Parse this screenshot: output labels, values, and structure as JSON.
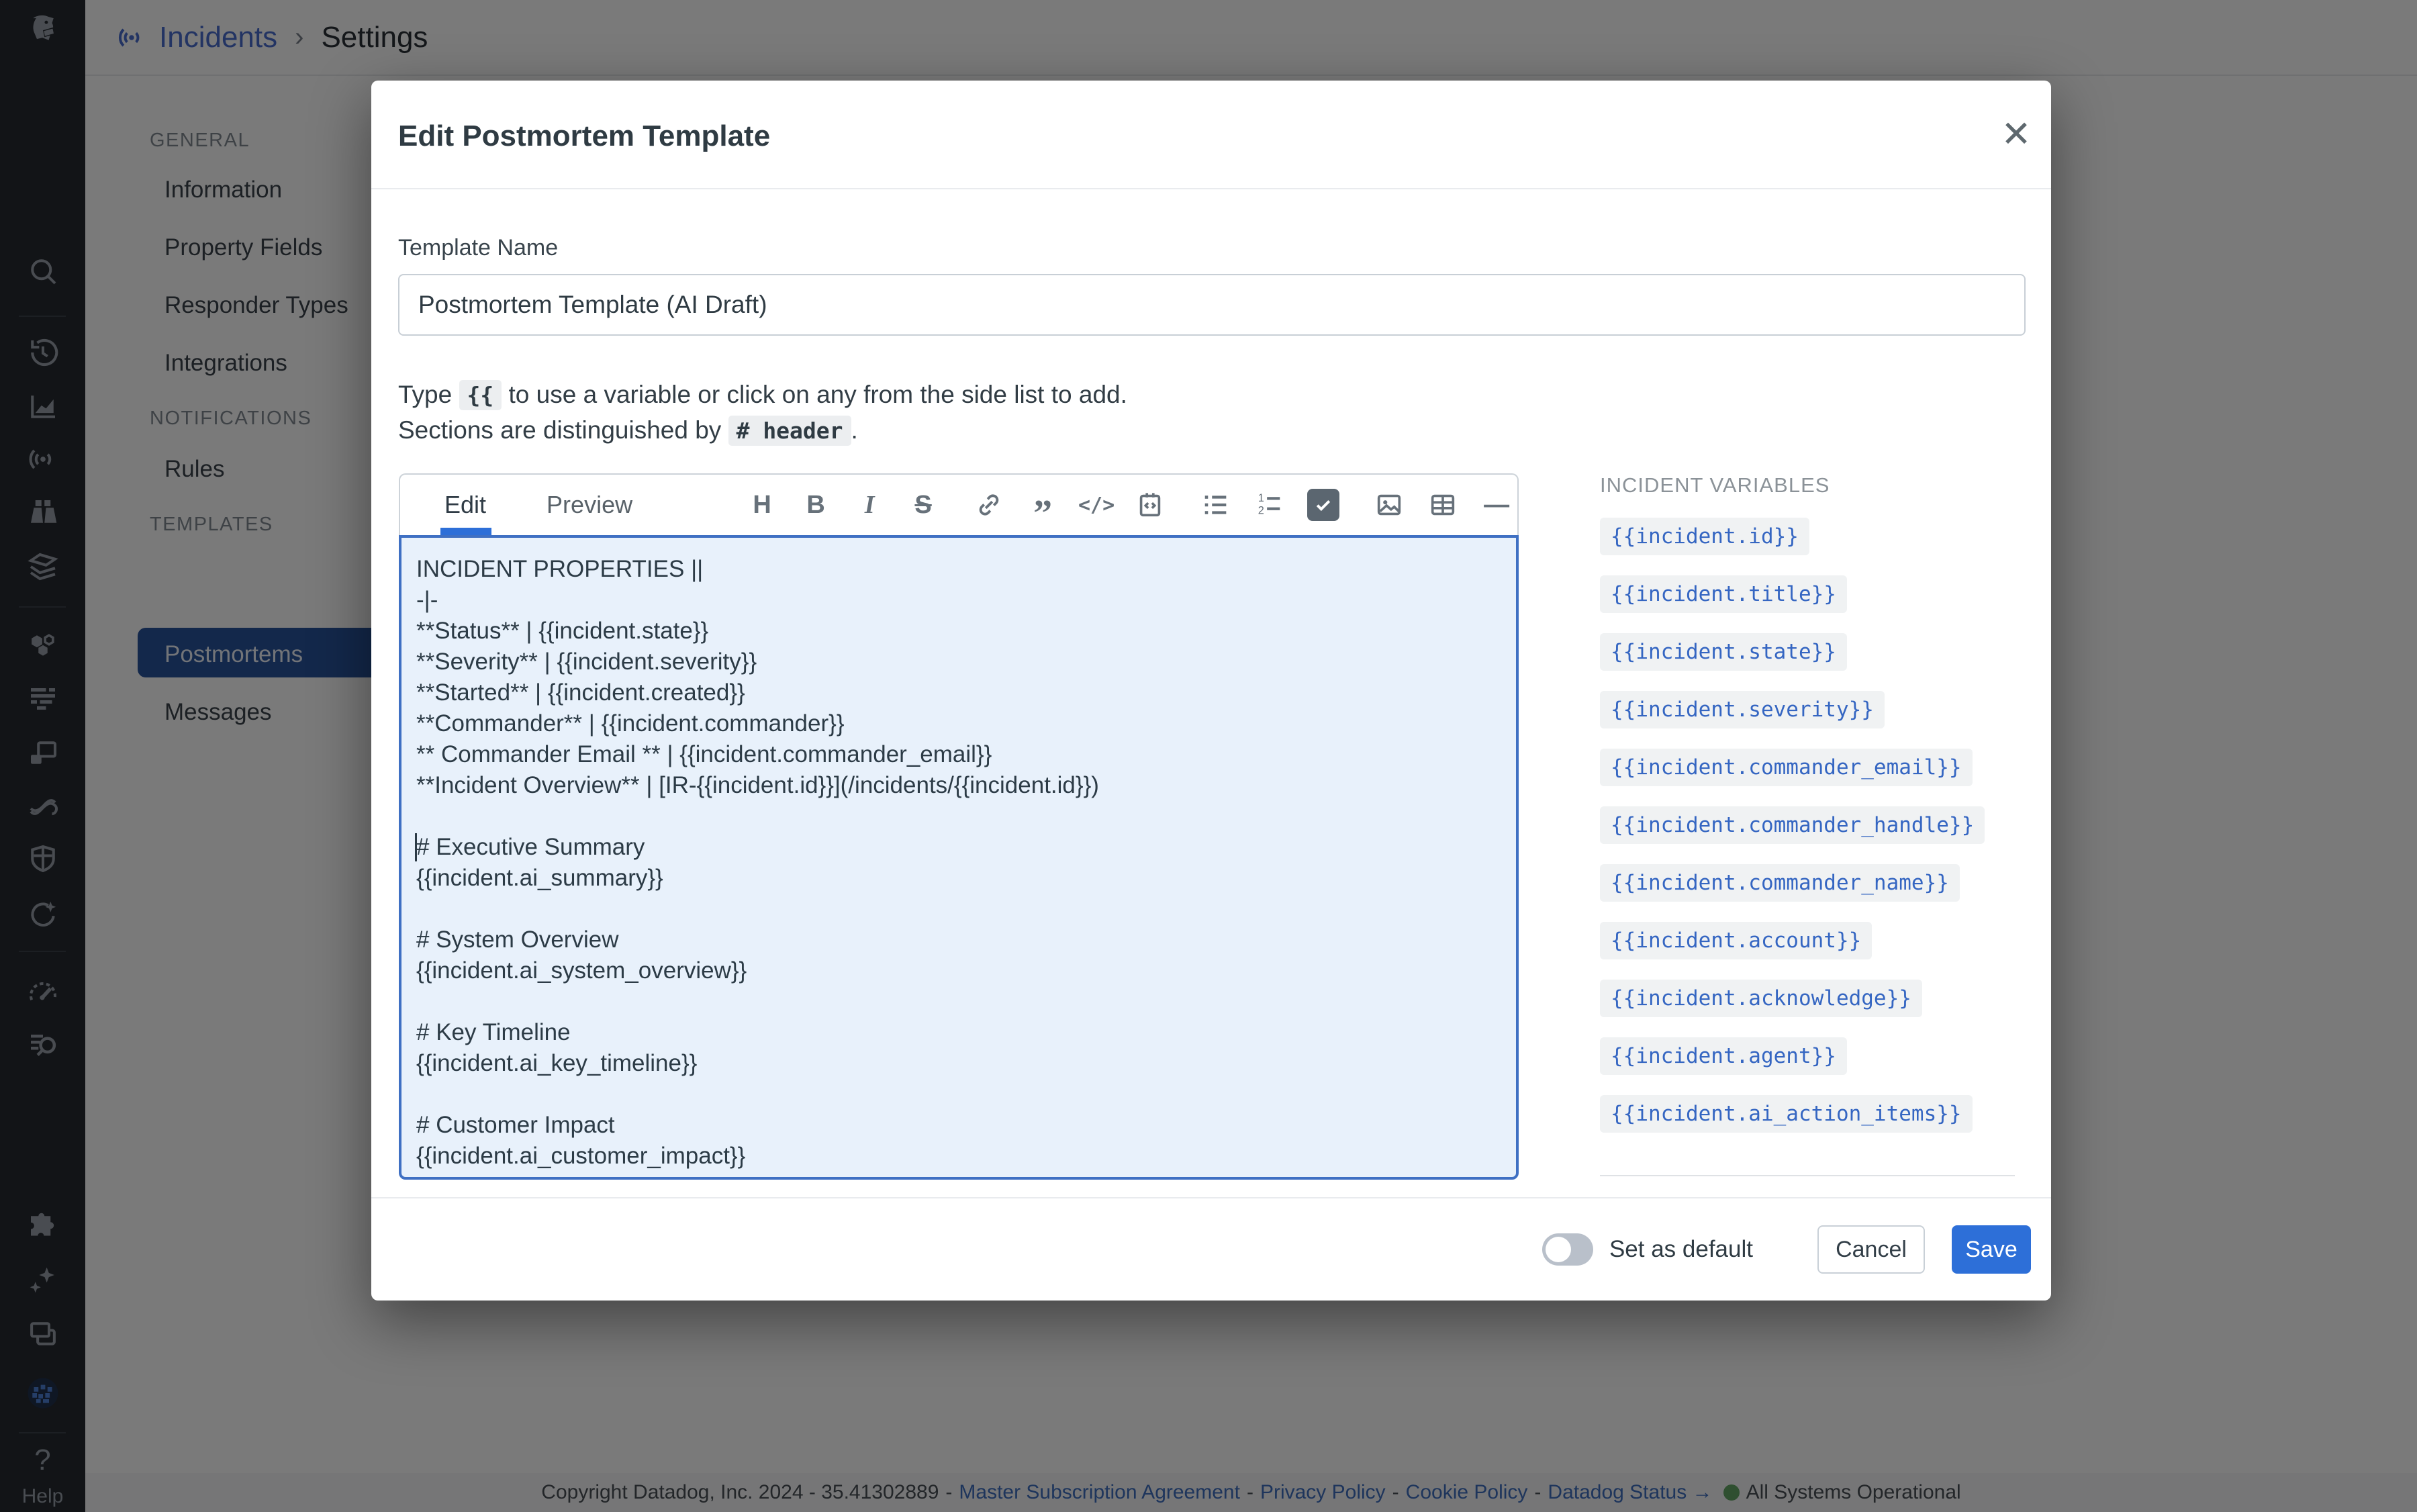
{
  "colors": {
    "accent_blue": "#2d6fd8",
    "editor_background": "#e8f1fb",
    "editor_border": "#3f70c3",
    "selected_nav_pill": "#29549e",
    "variable_text": "#3566c2",
    "status_green": "#62a564"
  },
  "rail": {
    "icons": [
      "datadog-logo",
      "search",
      "history",
      "metrics-chart",
      "incidents-radar",
      "watchdog-binoculars",
      "dashboards-layers",
      "infrastructure-hexagons",
      "logs-lines",
      "apm-windows",
      "pipelines-curve",
      "security-shield",
      "ai-circle-sparkle",
      "monitors-gauge",
      "log-explorer-search",
      "integrations-puzzle",
      "bits-ai-sparkles",
      "workflows-windows",
      "user-avatar-pixel-dog"
    ],
    "help_icon_glyph": "?",
    "help_label": "Help"
  },
  "header": {
    "breadcrumb": {
      "product": "Incidents",
      "separator": "›",
      "page": "Settings"
    }
  },
  "sidebar": {
    "sections": [
      {
        "label": "GENERAL",
        "items": [
          "Information",
          "Property Fields",
          "Responder Types",
          "Integrations"
        ]
      },
      {
        "label": "NOTIFICATIONS",
        "items": [
          "Rules"
        ]
      },
      {
        "label": "TEMPLATES",
        "items": [
          "Postmortems",
          "Messages"
        ],
        "selected_item": "Postmortems"
      }
    ]
  },
  "modal": {
    "title": "Edit Postmortem Template",
    "close_glyph": "✕",
    "template_name": {
      "label": "Template Name",
      "value": "Postmortem Template (AI Draft)"
    },
    "hint": {
      "line1_pre": "Type ",
      "code1": "{{",
      "line1_post": " to use a variable or click on any from the side list to add.",
      "line2_pre": "Sections are distinguished by ",
      "code2": "# header",
      "line2_post": "."
    },
    "editor": {
      "tabs": {
        "edit": "Edit",
        "preview": "Preview"
      },
      "active_tab": "Edit",
      "toolbar_glyphs": {
        "heading": "H",
        "bold": "B",
        "italic": "I",
        "strikethrough": "S",
        "quote": "”",
        "inline_code": "</>",
        "horizontal_rule": "—"
      },
      "lines": [
        "INCIDENT PROPERTIES ||",
        "-|-",
        "**Status** | {{incident.state}}",
        "**Severity** | {{incident.severity}}",
        "**Started** | {{incident.created}}",
        "**Commander** | {{incident.commander}}",
        "** Commander Email ** | {{incident.commander_email}}",
        "**Incident Overview** | [IR-{{incident.id}}](/incidents/{{incident.id}})",
        "",
        "# Executive Summary",
        "{{incident.ai_summary}}",
        "",
        "# System Overview",
        "{{incident.ai_system_overview}}",
        "",
        "# Key Timeline",
        "{{incident.ai_key_timeline}}",
        "",
        "# Customer Impact",
        "{{incident.ai_customer_impact}}"
      ]
    },
    "variables_panel": {
      "title": "INCIDENT VARIABLES",
      "variables": [
        "{{incident.id}}",
        "{{incident.title}}",
        "{{incident.state}}",
        "{{incident.severity}}",
        "{{incident.commander_email}}",
        "{{incident.commander_handle}}",
        "{{incident.commander_name}}",
        "{{incident.account}}",
        "{{incident.acknowledge}}",
        "{{incident.agent}}",
        "{{incident.ai_action_items}}"
      ]
    },
    "footer": {
      "toggle_label": "Set as default",
      "toggle_state": "off",
      "cancel_label": "Cancel",
      "save_label": "Save"
    }
  },
  "page_footer": {
    "copyright": "Copyright Datadog, Inc. 2024 - 35.41302889",
    "separator": "-",
    "links": [
      "Master Subscription Agreement",
      "Privacy Policy",
      "Cookie Policy",
      "Datadog Status →"
    ],
    "status_text": "All Systems Operational"
  }
}
